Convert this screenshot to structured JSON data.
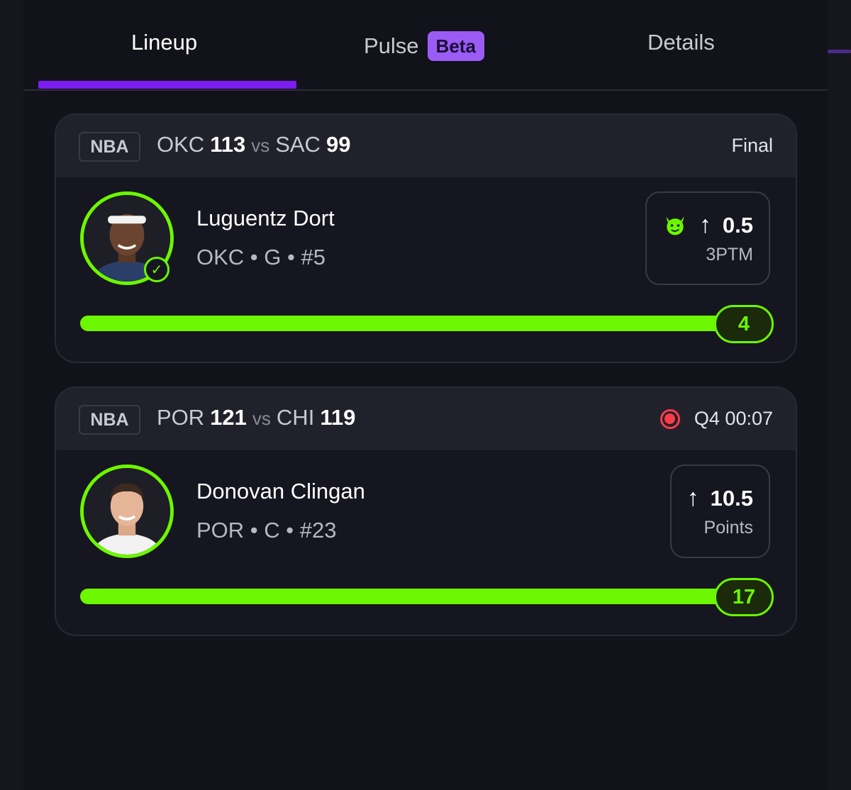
{
  "tabs": {
    "lineup": "Lineup",
    "pulse": "Pulse",
    "pulse_badge": "Beta",
    "details": "Details",
    "active": "Lineup"
  },
  "colors": {
    "accent_purple": "#7b1cf0",
    "badge_purple": "#9b5cf6",
    "progress_green": "#6cf700",
    "live_red": "#ff3b47"
  },
  "cards": [
    {
      "league": "NBA",
      "team1": "OKC",
      "score1": "113",
      "vs": "vs",
      "team2": "SAC",
      "score2": "99",
      "status": "Final",
      "live": false,
      "player": {
        "name": "Luguentz Dort",
        "meta": "OKC • G • #5",
        "verified": true
      },
      "pick": {
        "icon": "devil-icon",
        "direction_icon": "arrow-up-icon",
        "line": "0.5",
        "stat": "3PTM"
      },
      "progress": {
        "value": "4",
        "fraction": 1.0
      }
    },
    {
      "league": "NBA",
      "team1": "POR",
      "score1": "121",
      "vs": "vs",
      "team2": "CHI",
      "score2": "119",
      "status": "Q4 00:07",
      "live": true,
      "player": {
        "name": "Donovan Clingan",
        "meta": "POR • C • #23",
        "verified": false
      },
      "pick": {
        "direction_icon": "arrow-up-icon",
        "line": "10.5",
        "stat": "Points"
      },
      "progress": {
        "value": "17",
        "fraction": 1.0
      }
    }
  ]
}
